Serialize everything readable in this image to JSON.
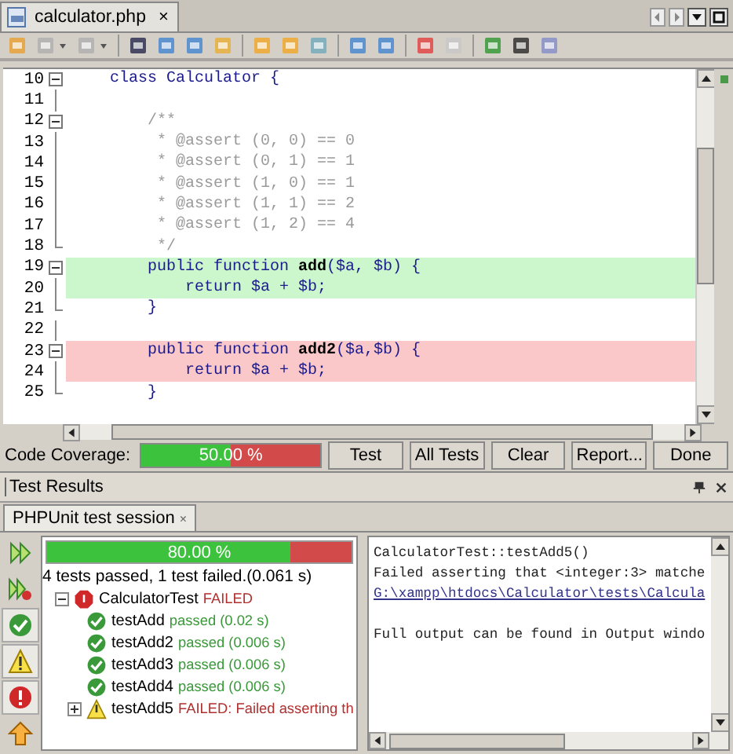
{
  "editor_tab": {
    "title": "calculator.php",
    "close": "×",
    "selected": true
  },
  "code_lines": [
    {
      "number": "10",
      "kind": "plain",
      "foldable": true,
      "fold_end": false,
      "text": "    class Calculator {"
    },
    {
      "number": "11",
      "kind": "plain",
      "foldable": false,
      "fold_end": false
    },
    {
      "number": "12",
      "kind": "comment",
      "foldable": true,
      "fold_end": false,
      "text": "        /**"
    },
    {
      "number": "13",
      "kind": "comment",
      "foldable": false,
      "fold_end": false,
      "text": "         * @assert (0, 0) == 0"
    },
    {
      "number": "14",
      "kind": "comment",
      "foldable": false,
      "fold_end": false,
      "text": "         * @assert (0, 1) == 1"
    },
    {
      "number": "15",
      "kind": "comment",
      "foldable": false,
      "fold_end": false,
      "text": "         * @assert (1, 0) == 1"
    },
    {
      "number": "16",
      "kind": "comment",
      "foldable": false,
      "fold_end": false,
      "text": "         * @assert (1, 1) == 2"
    },
    {
      "number": "17",
      "kind": "comment",
      "foldable": false,
      "fold_end": false,
      "text": "         * @assert (1, 2) == 4"
    },
    {
      "number": "18",
      "kind": "comment",
      "foldable": false,
      "fold_end": true,
      "text": "         */"
    },
    {
      "number": "19",
      "kind": "covered",
      "foldable": true,
      "fold_end": false,
      "text": "        public function **add**($a, $b) {"
    },
    {
      "number": "20",
      "kind": "covered",
      "foldable": false,
      "fold_end": false,
      "text": "            return $a + $b;"
    },
    {
      "number": "21",
      "kind": "plain",
      "foldable": false,
      "fold_end": true,
      "text": "        }"
    },
    {
      "number": "22",
      "kind": "plain",
      "foldable": false,
      "fold_end": false
    },
    {
      "number": "23",
      "kind": "uncovered",
      "foldable": true,
      "fold_end": false,
      "text": "        public function **add2**($a,$b) {"
    },
    {
      "number": "24",
      "kind": "uncovered",
      "foldable": false,
      "fold_end": false,
      "text": "            return $a + $b;"
    },
    {
      "number": "25",
      "kind": "plain",
      "foldable": false,
      "fold_end": true,
      "text": "        }"
    }
  ],
  "coverage": {
    "label": "Code Coverage:",
    "level": 0.5,
    "reading": "50.00 %"
  },
  "coverage_buttons": [
    "Test",
    "All Tests",
    "Clear",
    "Report...",
    "Done"
  ],
  "results_panel": {
    "title": "Test Results"
  },
  "session_tab": {
    "title": "PHPUnit test session",
    "close": "×",
    "selected": true
  },
  "side_buttons": [
    {
      "kind": "rerun",
      "selected": false
    },
    {
      "kind": "rerun-failed",
      "selected": false
    },
    {
      "kind": "passed",
      "selected": true
    },
    {
      "kind": "warning",
      "selected": true
    },
    {
      "kind": "failure",
      "selected": true
    },
    {
      "kind": "previous",
      "selected": false
    }
  ],
  "test_progress": {
    "level": 0.8,
    "reading": "80.00 %"
  },
  "summary": "4 tests passed, 1 test failed.(0.061 s)",
  "tree": [
    {
      "name": "CalculatorTest",
      "result": "FAILED",
      "kind": "failed",
      "expanded": true,
      "children": [
        {
          "name": "testAdd",
          "result": "passed  (0.02 s)",
          "kind": "passed"
        },
        {
          "name": "testAdd2",
          "result": "passed  (0.006 s)",
          "kind": "passed"
        },
        {
          "name": "testAdd3",
          "result": "passed  (0.006 s)",
          "kind": "passed"
        },
        {
          "name": "testAdd4",
          "result": "passed  (0.006 s)",
          "kind": "passed"
        },
        {
          "name": "testAdd5",
          "result": "FAILED: Failed asserting th",
          "kind": "warning",
          "expanded": false
        }
      ]
    }
  ],
  "output_lines": [
    {
      "text": "CalculatorTest::testAdd5()",
      "kind": "plain"
    },
    {
      "text": "Failed asserting that <integer:3> matche",
      "kind": "plain"
    },
    {
      "text": "G:\\xampp\\htdocs\\Calculator\\tests\\Calcula",
      "kind": "link"
    },
    {
      "text": "Full output can be found in Output windo",
      "kind": "note"
    }
  ]
}
